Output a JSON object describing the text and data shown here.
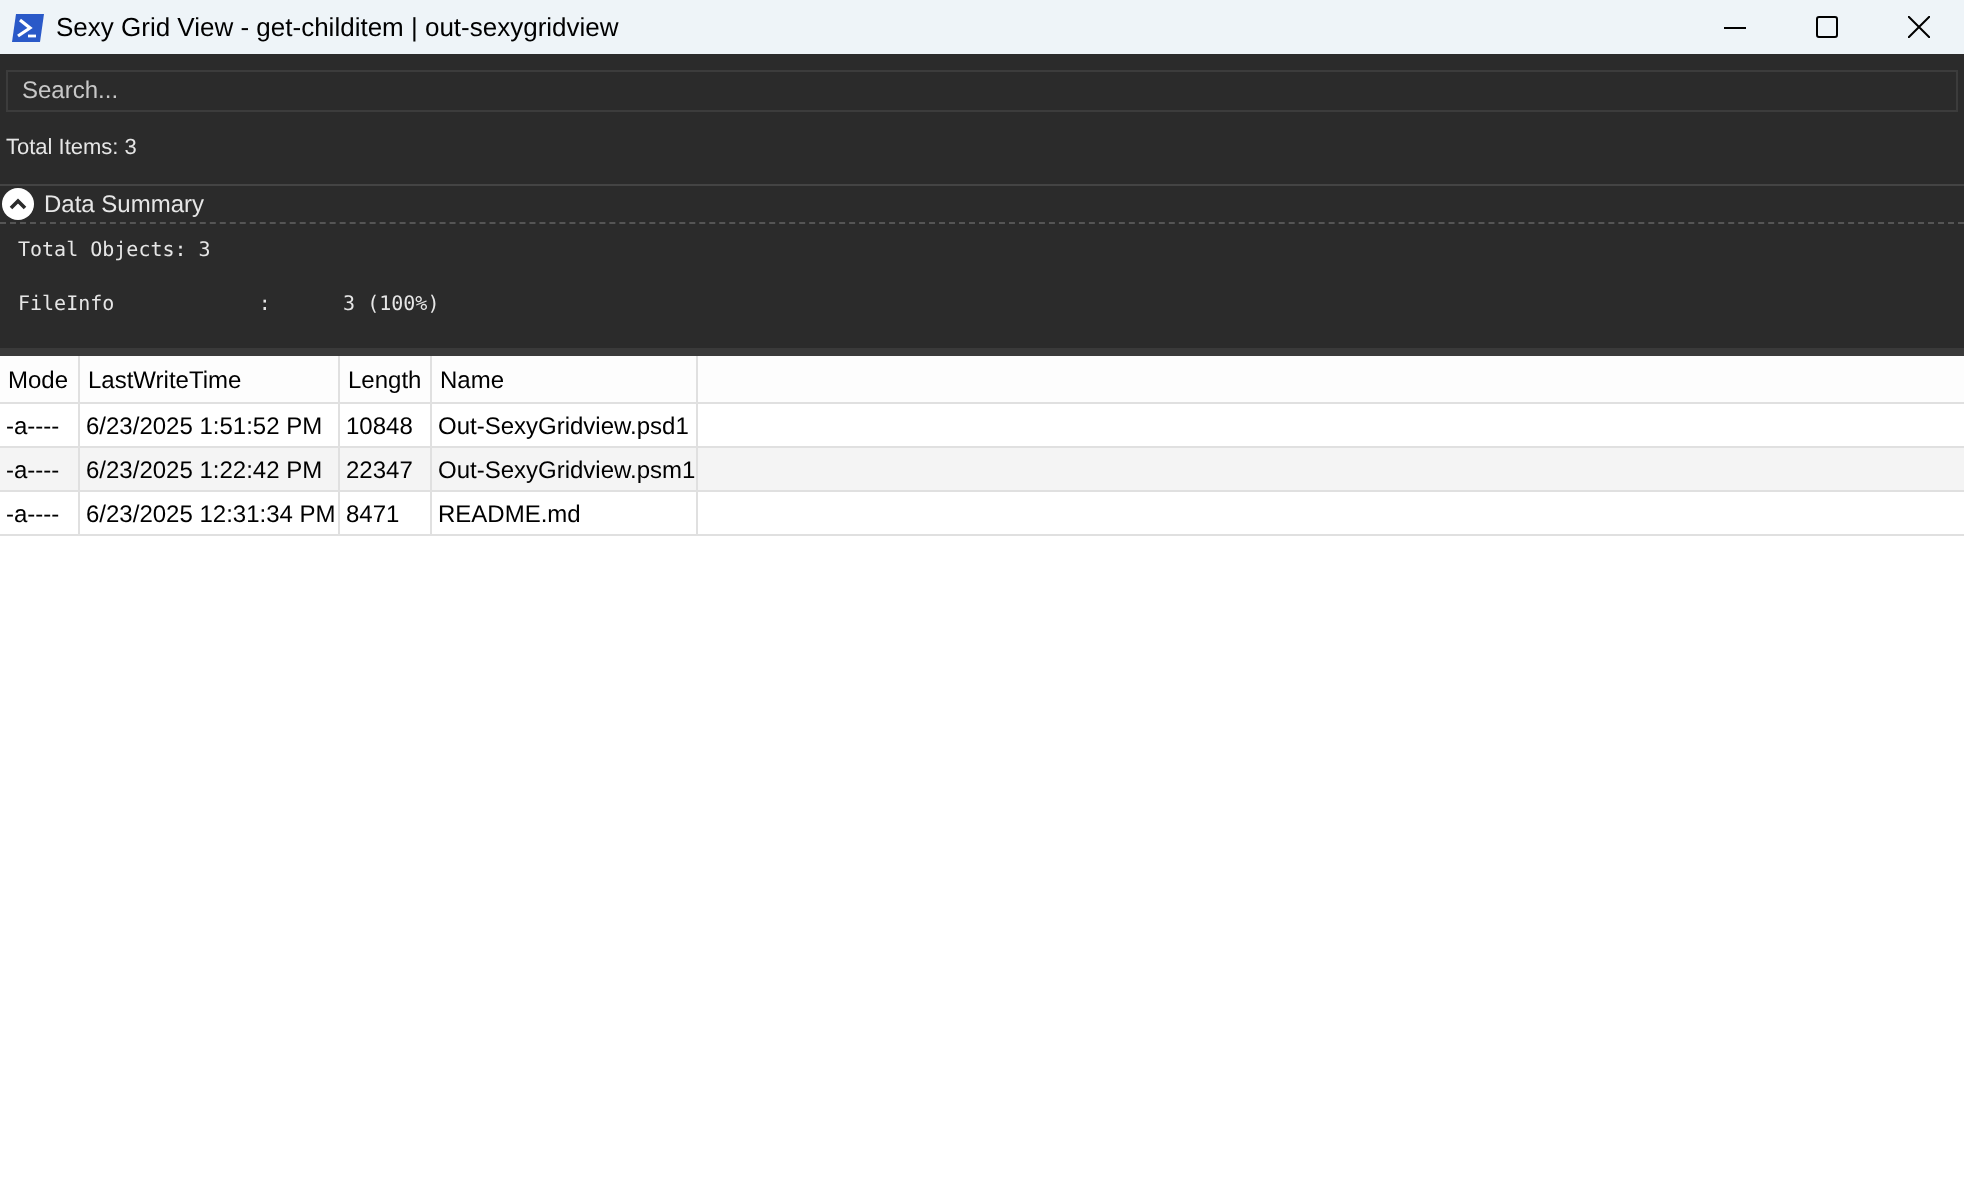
{
  "window": {
    "title": "Sexy Grid View - get-childitem | out-sexygridview"
  },
  "search": {
    "placeholder": "Search..."
  },
  "total_items": "Total Items: 3",
  "summary": {
    "title": "Data Summary",
    "expanded": true,
    "lines": [
      "Total Objects: 3",
      "FileInfo            :      3 (100%)"
    ]
  },
  "table": {
    "columns": [
      "Mode",
      "LastWriteTime",
      "Length",
      "Name"
    ],
    "rows": [
      [
        "-a----",
        "6/23/2025 1:51:52 PM",
        "10848",
        "Out-SexyGridview.psd1"
      ],
      [
        "-a----",
        "6/23/2025 1:22:42 PM",
        "22347",
        "Out-SexyGridview.psm1"
      ],
      [
        "-a----",
        "6/23/2025 12:31:34 PM",
        "8471",
        "README.md"
      ]
    ]
  }
}
